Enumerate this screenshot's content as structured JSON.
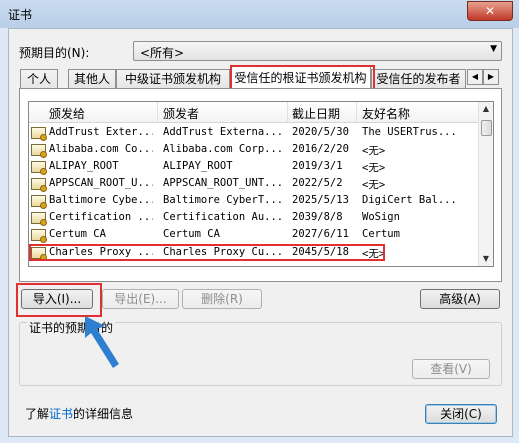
{
  "window": {
    "title": "证书",
    "close_glyph": "✕"
  },
  "purpose": {
    "label": "预期目的(N):",
    "value": "<所有>",
    "arrow": "▼"
  },
  "tabs": [
    {
      "label": "个人"
    },
    {
      "label": "其他人"
    },
    {
      "label": "中级证书颁发机构"
    },
    {
      "label": "受信任的根证书颁发机构",
      "active": true
    },
    {
      "label": "受信任的发布者"
    }
  ],
  "tab_scroll": {
    "left": "◀",
    "right": "▶"
  },
  "table": {
    "columns": [
      "颁发给",
      "颁发者",
      "截止日期",
      "友好名称"
    ],
    "rows": [
      {
        "issued_to": "AddTrust Exter...",
        "issued_by": "AddTrust Externa...",
        "expires": "2020/5/30",
        "friendly": "The USERTrus..."
      },
      {
        "issued_to": "Alibaba.com Co...",
        "issued_by": "Alibaba.com Corp...",
        "expires": "2016/2/20",
        "friendly": "<无>"
      },
      {
        "issued_to": "ALIPAY_ROOT",
        "issued_by": "ALIPAY_ROOT",
        "expires": "2019/3/1",
        "friendly": "<无>"
      },
      {
        "issued_to": "APPSCAN_ROOT_U...",
        "issued_by": "APPSCAN_ROOT_UNT...",
        "expires": "2022/5/2",
        "friendly": "<无>"
      },
      {
        "issued_to": "Baltimore Cybe...",
        "issued_by": "Baltimore CyberT...",
        "expires": "2025/5/13",
        "friendly": "DigiCert Bal..."
      },
      {
        "issued_to": "Certification ...",
        "issued_by": "Certification Au...",
        "expires": "2039/8/8",
        "friendly": "WoSign"
      },
      {
        "issued_to": "Certum CA",
        "issued_by": "Certum CA",
        "expires": "2027/6/11",
        "friendly": "Certum"
      },
      {
        "issued_to": "Charles Proxy ...",
        "issued_by": "Charles Proxy Cu...",
        "expires": "2045/5/18",
        "friendly": "<无>"
      }
    ],
    "scroll_up": "▲",
    "scroll_down": "▼"
  },
  "buttons": {
    "import": "导入(I)...",
    "export": "导出(E)...",
    "remove": "删除(R)",
    "advanced": "高级(A)",
    "view": "查看(V)",
    "close": "关闭(C)"
  },
  "group": {
    "label": "证书的预期目的"
  },
  "footer": {
    "prefix": "了解",
    "link": "证书",
    "suffix": "的详细信息"
  },
  "colors": {
    "highlight": "#e03030",
    "arrow": "#2f7fd1",
    "link": "#0066cc"
  }
}
